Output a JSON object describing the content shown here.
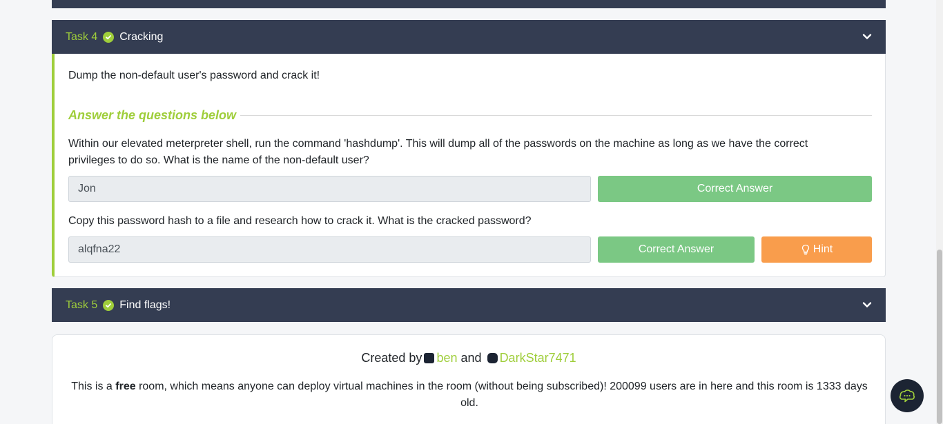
{
  "task4": {
    "number": "Task 4",
    "title": "Cracking",
    "description": "Dump the non-default user's password and crack it!",
    "answer_heading": "Answer the questions below",
    "questions": [
      {
        "text": "Within our elevated meterpreter shell, run the command 'hashdump'. This will dump all of the passwords on the machine as long as we have the correct privileges to do so. What is the name of the non-default user?",
        "answer": "Jon",
        "button_label": "Correct Answer"
      },
      {
        "text": "Copy this password hash to a file and research how to crack it. What is the cracked password?",
        "answer": "alqfna22",
        "button_label": "Correct Answer",
        "hint_label": "Hint"
      }
    ]
  },
  "task5": {
    "number": "Task 5",
    "title": "Find flags!"
  },
  "footer": {
    "created_by": "Created by",
    "and": "and",
    "author1": "ben",
    "author2": "DarkStar7471",
    "info_prefix": "This is a",
    "info_free": "free",
    "info_suffix": "room, which means anyone can deploy virtual machines in the room (without being subscribed)! 200099 users are in here and this room is 1333 days old."
  },
  "colors": {
    "header_bg": "#343d52",
    "accent_green": "#9fce3b",
    "correct_button": "#7bc884",
    "hint_button": "#f99d4c"
  }
}
